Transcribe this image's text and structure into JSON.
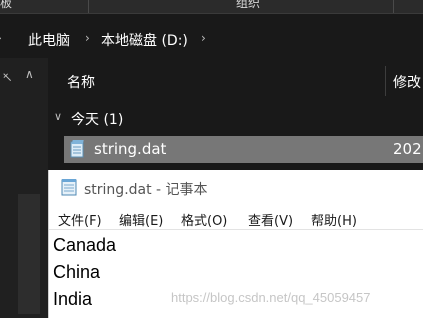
{
  "ribbon": {
    "left_label": "板",
    "mid_label": "组织"
  },
  "address": {
    "crumbs": [
      "此电脑",
      "本地磁盘 (D:)"
    ]
  },
  "file_list": {
    "column_name": "名称",
    "column_modified": "修改",
    "group_label": "今天 (1)",
    "file": {
      "name": "string.dat",
      "date": "202"
    }
  },
  "notepad": {
    "title": "string.dat - 记事本",
    "menu": [
      "文件(F)",
      "编辑(E)",
      "格式(O)",
      "查看(V)",
      "帮助(H)"
    ],
    "lines": [
      "Canada",
      "China",
      "India"
    ]
  },
  "watermark": "https://blog.csdn.net/qq_45059457",
  "colors": {
    "explorer_bg": "#191919",
    "selected_row": "#777777",
    "notepad_bg": "#ffffff"
  },
  "icons": [
    "pin-icon",
    "chevron-up-icon",
    "chevron-right-icon",
    "chevron-down-icon",
    "dat-file-icon",
    "notepad-icon"
  ]
}
